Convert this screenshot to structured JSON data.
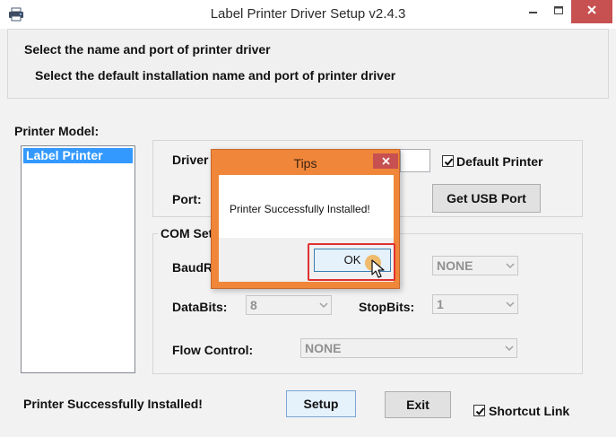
{
  "window": {
    "title": "Label Printer Driver Setup v2.4.3"
  },
  "header": {
    "title": "Select the name and port of printer driver",
    "subtitle": "Select the default installation name and port of printer driver"
  },
  "printer_model": {
    "label": "Printer Model:",
    "items": [
      "Label Printer"
    ],
    "selected": "Label Printer"
  },
  "driver": {
    "label_visible": "Driver",
    "port_label": "Port:",
    "default_printer_label": "Default Printer",
    "default_printer_checked": true,
    "get_usb_port_label": "Get USB Port"
  },
  "com_settings": {
    "group_label_visible": "COM Set",
    "baudrate_label_visible": "BaudR",
    "parity_value": "NONE",
    "databits_label": "DataBits:",
    "databits_value": "8",
    "stopbits_label": "StopBits:",
    "stopbits_value": "1",
    "flow_control_label": "Flow Control:",
    "flow_control_value": "NONE"
  },
  "footer": {
    "status": "Printer Successfully Installed!",
    "setup_label": "Setup",
    "exit_label": "Exit",
    "shortcut_label": "Shortcut Link",
    "shortcut_checked": true
  },
  "dialog": {
    "title": "Tips",
    "message": "Printer Successfully Installed!",
    "ok_label": "OK"
  },
  "colors": {
    "dialog_frame": "#f0863a",
    "close_button": "#c75050",
    "selection": "#3399ff",
    "highlight_box": "#e03030"
  },
  "icons": [
    "printer-icon",
    "minimize-icon",
    "maximize-icon",
    "close-icon",
    "checkmark-icon",
    "chevron-down-icon",
    "mouse-cursor-icon"
  ]
}
